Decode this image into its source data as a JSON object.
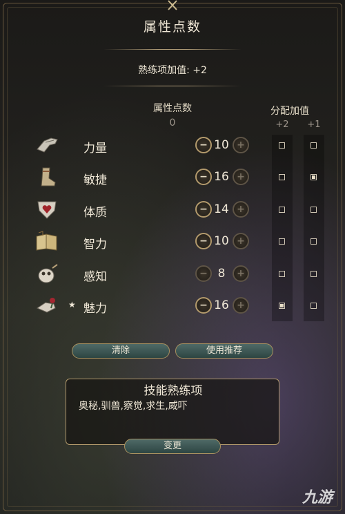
{
  "title": "属性点数",
  "proficiency_bonus": "熟练项加值: +2",
  "columns": {
    "points_label": "属性点数",
    "points_value": "0",
    "allocation_label": "分配加值",
    "plus2": "+2",
    "plus1": "+1"
  },
  "abilities": [
    {
      "name": "力量",
      "value": "10",
      "icon": "gauntlet-icon",
      "starred": false,
      "plus2": false,
      "plus1": false,
      "minus_enabled": true
    },
    {
      "name": "敏捷",
      "value": "16",
      "icon": "boot-icon",
      "starred": false,
      "plus2": false,
      "plus1": true,
      "minus_enabled": true
    },
    {
      "name": "体质",
      "value": "14",
      "icon": "heart-shield-icon",
      "starred": false,
      "plus2": false,
      "plus1": false,
      "minus_enabled": true
    },
    {
      "name": "智力",
      "value": "10",
      "icon": "book-icon",
      "starred": false,
      "plus2": false,
      "plus1": false,
      "minus_enabled": true
    },
    {
      "name": "感知",
      "value": "8",
      "icon": "owl-icon",
      "starred": false,
      "plus2": false,
      "plus1": false,
      "minus_enabled": false
    },
    {
      "name": "魅力",
      "value": "16",
      "icon": "hand-rose-icon",
      "starred": true,
      "plus2": true,
      "plus1": false,
      "minus_enabled": true
    }
  ],
  "star_glyph": "★",
  "buttons": {
    "clear": "清除",
    "recommended": "使用推荐",
    "change": "变更"
  },
  "skills": {
    "title": "技能熟练项",
    "list": "奥秘,驯兽,察觉,求生,威吓"
  },
  "watermark": "九游"
}
